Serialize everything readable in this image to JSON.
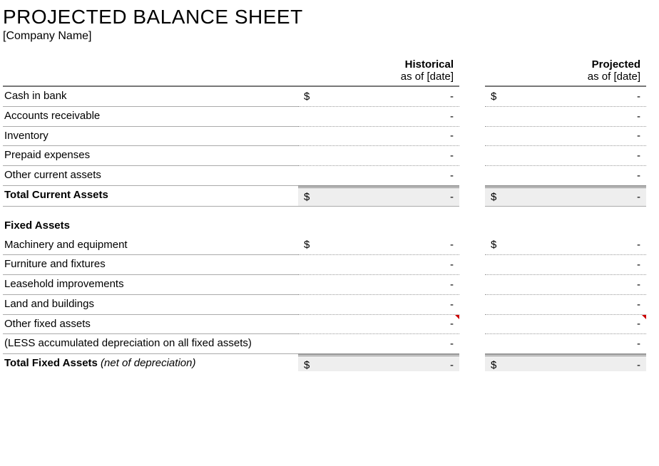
{
  "title": "PROJECTED BALANCE SHEET",
  "company": "[Company Name]",
  "columns": {
    "historical": {
      "title": "Historical",
      "sub": "as of [date]"
    },
    "projected": {
      "title": "Projected",
      "sub": "as of [date]"
    }
  },
  "dash": "-",
  "currency": "$",
  "current_assets": {
    "rows": [
      {
        "label": "Cash in bank",
        "sym": true
      },
      {
        "label": "Accounts receivable",
        "sym": false
      },
      {
        "label": "Inventory",
        "sym": false
      },
      {
        "label": "Prepaid expenses",
        "sym": false
      },
      {
        "label": "Other current assets",
        "sym": false
      }
    ],
    "total_label": "Total Current Assets"
  },
  "fixed_assets": {
    "section_title": "Fixed Assets",
    "rows": [
      {
        "label": "Machinery and equipment",
        "sym": true
      },
      {
        "label": "Furniture and fixtures",
        "sym": false
      },
      {
        "label": "Leasehold improvements",
        "sym": false
      },
      {
        "label": "Land and buildings",
        "sym": false
      },
      {
        "label": "Other fixed assets",
        "sym": false,
        "note": true
      },
      {
        "label": "(LESS accumulated depreciation on all fixed assets)",
        "sym": false
      }
    ],
    "total_label": "Total Fixed Assets",
    "total_note": "(net of depreciation)"
  }
}
